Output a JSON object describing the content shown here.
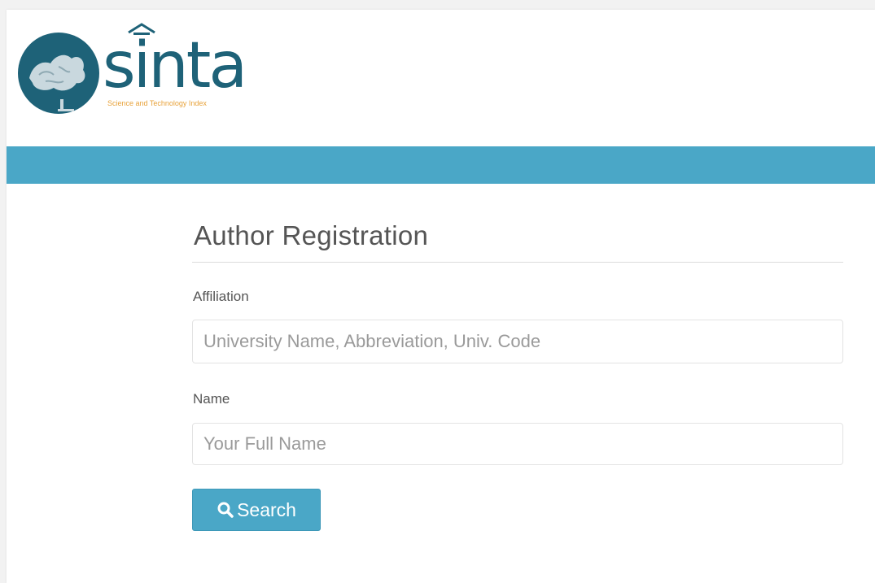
{
  "brand": {
    "name": "sinta",
    "tagline": "Science and Technology Index",
    "colors": {
      "primary": "#1e6278",
      "accent": "#e8a23a",
      "navbar": "#4aa7c7"
    }
  },
  "form": {
    "title": "Author Registration",
    "affiliation": {
      "label": "Affiliation",
      "placeholder": "University Name, Abbreviation, Univ. Code",
      "value": ""
    },
    "name": {
      "label": "Name",
      "placeholder": "Your Full Name",
      "value": ""
    },
    "search_button": {
      "label": "Search",
      "icon": "search-icon"
    }
  }
}
